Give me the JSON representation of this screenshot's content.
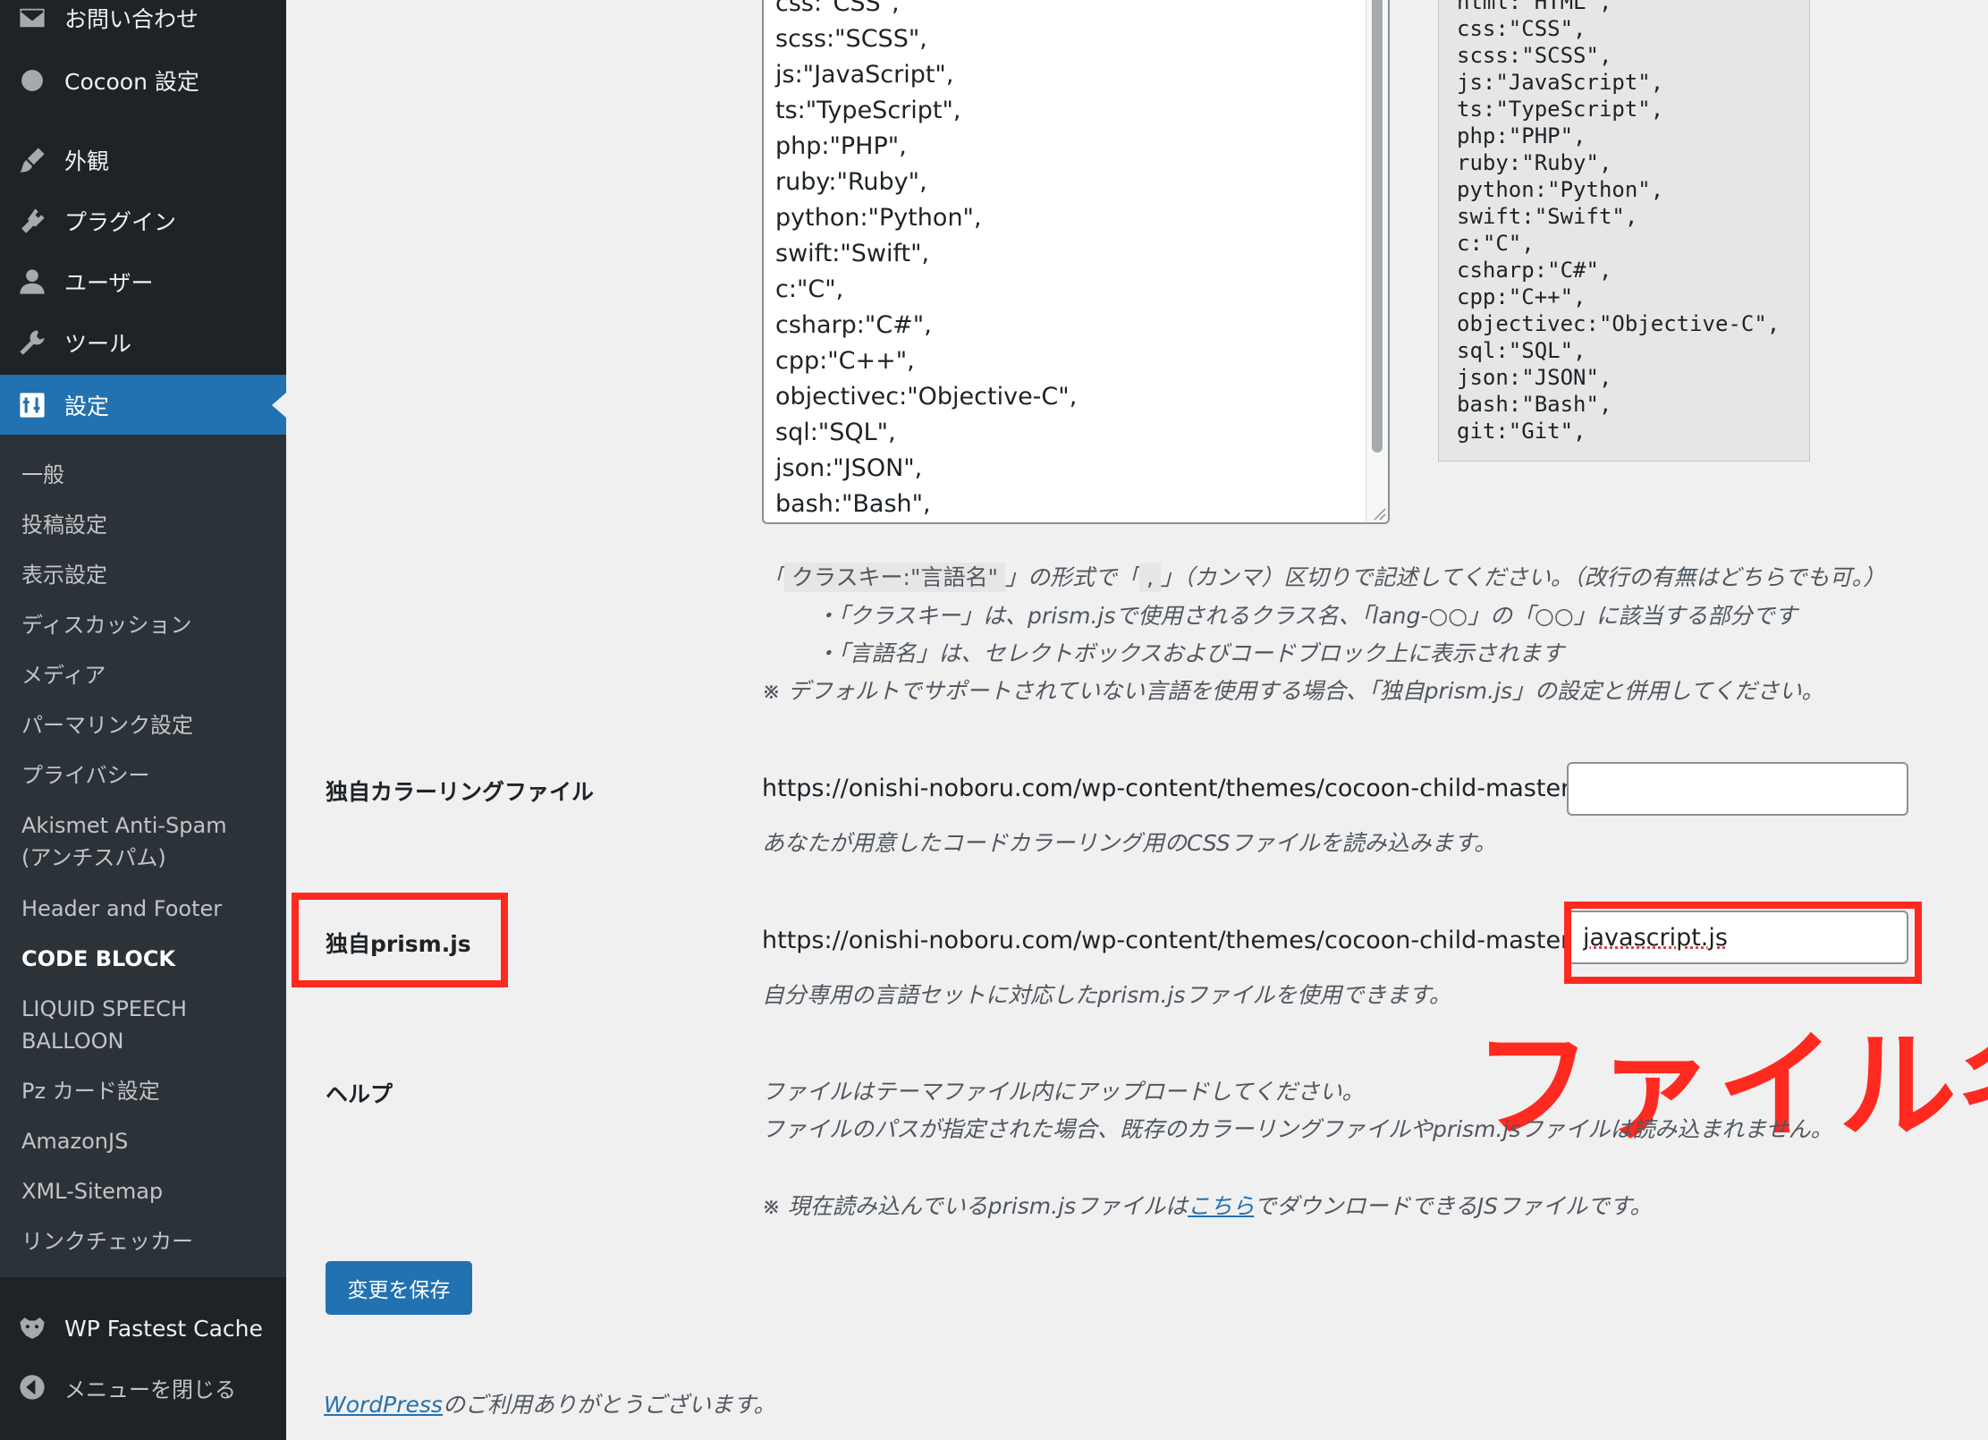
{
  "colors": {
    "sidebar_bg": "#1d2327",
    "submenu_bg": "#2c3338",
    "accent": "#2271b1",
    "annotation_red": "#ff2a1f"
  },
  "sidebar": {
    "menu": [
      {
        "label": "お問い合わせ",
        "icon": "mail-icon"
      },
      {
        "label": "Cocoon 設定",
        "icon": "cocoon-icon"
      },
      {
        "label": "外観",
        "icon": "paintbrush-icon"
      },
      {
        "label": "プラグイン",
        "icon": "plugin-icon"
      },
      {
        "label": "ユーザー",
        "icon": "user-icon"
      },
      {
        "label": "ツール",
        "icon": "wrench-icon"
      },
      {
        "label": "設定",
        "icon": "settings-icon"
      }
    ],
    "submenu": [
      "一般",
      "投稿設定",
      "表示設定",
      "ディスカッション",
      "メディア",
      "パーマリンク設定",
      "プライバシー",
      "Akismet Anti-Spam",
      "(アンチスパム)",
      "Header and Footer",
      "CODE BLOCK",
      "LIQUID SPEECH",
      "BALLOON",
      "Pz カード設定",
      "AmazonJS",
      "XML-Sitemap",
      "リンクチェッカー"
    ],
    "bottom": [
      {
        "label": "WP Fastest Cache",
        "icon": "cheetah-icon"
      },
      {
        "label": "メニューを閉じる",
        "icon": "collapse-icon"
      }
    ]
  },
  "language_textarea": {
    "lines": [
      "css:\"CSS\",",
      "scss:\"SCSS\",",
      "js:\"JavaScript\",",
      "ts:\"TypeScript\",",
      "php:\"PHP\",",
      "ruby:\"Ruby\",",
      "python:\"Python\",",
      "swift:\"Swift\",",
      "c:\"C\",",
      "csharp:\"C#\",",
      "cpp:\"C++\",",
      "objectivec:\"Objective-C\",",
      "sql:\"SQL\",",
      "json:\"JSON\",",
      "bash:\"Bash\","
    ]
  },
  "default_preview": {
    "lines": [
      "html:\"HTML\",",
      "css:\"CSS\",",
      "scss:\"SCSS\",",
      "js:\"JavaScript\",",
      "ts:\"TypeScript\",",
      "php:\"PHP\",",
      "ruby:\"Ruby\",",
      "python:\"Python\",",
      "swift:\"Swift\",",
      "c:\"C\",",
      "csharp:\"C#\",",
      "cpp:\"C++\",",
      "objectivec:\"Objective-C\",",
      "sql:\"SQL\",",
      "json:\"JSON\",",
      "bash:\"Bash\",",
      "git:\"Git\","
    ]
  },
  "language_help": {
    "prefix": "「",
    "key_format": "クラスキー:\"言語名\"",
    "middle": "」の形式で「",
    "comma": ",",
    "suffix": "」（カンマ）区切りで記述してください。（改行の有無はどちらでも可。）",
    "bullet1": "・「クラスキー」は、prism.jsで使用されるクラス名、「lang-○○」の「○○」に該当する部分です",
    "bullet2": "・「言語名」は、セレクトボックスおよびコードブロック上に表示されます",
    "note": "※ デフォルトでサポートされていない言語を使用する場合、「独自prism.js」の設定と併用してください。"
  },
  "coloring_file": {
    "label": "独自カラーリングファイル",
    "url": "https://onishi-noboru.com/wp-content/themes/cocoon-child-master/",
    "value": "",
    "desc": "あなたが用意したコードカラーリング用のCSSファイルを読み込みます。"
  },
  "prism_file": {
    "label": "独自prism.js",
    "url": "https://onishi-noboru.com/wp-content/themes/cocoon-child-master/",
    "value": "javascript.js",
    "desc": "自分専用の言語セットに対応したprism.jsファイルを使用できます。"
  },
  "annotation": "ファイル名",
  "help": {
    "label": "ヘルプ",
    "line1": "ファイルはテーマファイル内にアップロードしてください。",
    "line2": "ファイルのパスが指定された場合、既存のカラーリングファイルやprism.jsファイルは読み込まれません。",
    "note_prefix": "※ 現在読み込んでいるprism.jsファイルは",
    "note_link": "こちら",
    "note_suffix": "でダウンロードできるJSファイルです。"
  },
  "save_button": "変更を保存",
  "footer": {
    "link": "WordPress",
    "text": "のご利用ありがとうございます。"
  }
}
